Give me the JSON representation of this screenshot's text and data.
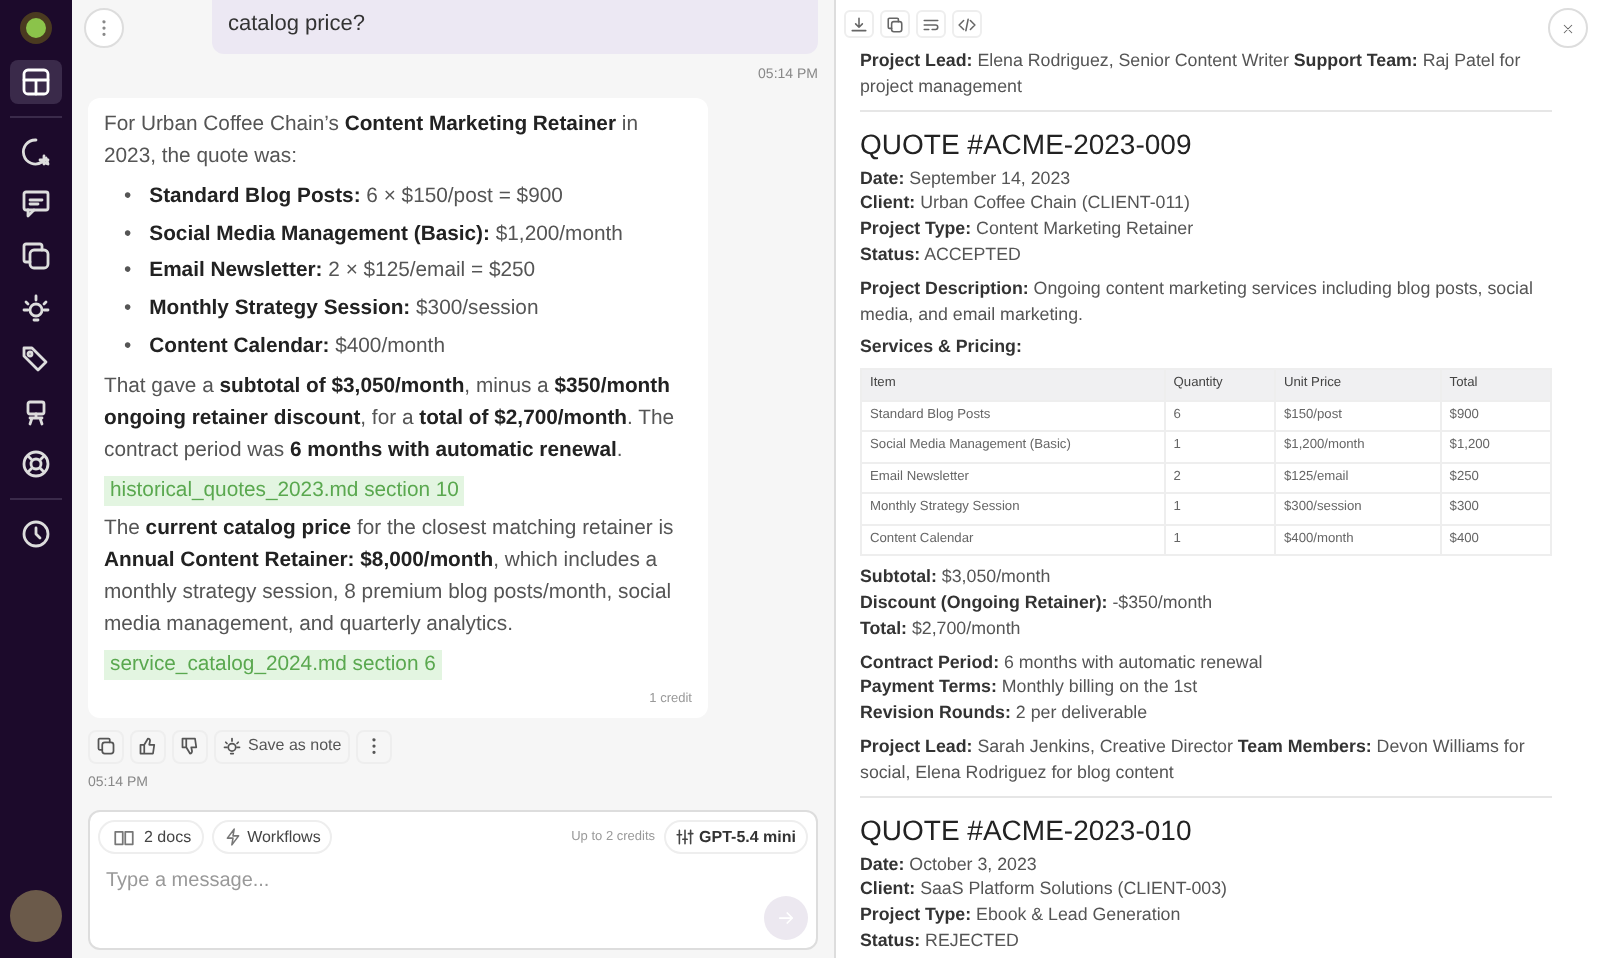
{
  "sidebar": {
    "items": [
      {
        "selected": true
      },
      {
        "selected": false
      },
      {
        "selected": false
      },
      {
        "selected": false
      },
      {
        "selected": false
      },
      {
        "selected": false
      },
      {
        "selected": false
      },
      {
        "selected": false
      },
      {
        "selected": false
      }
    ]
  },
  "chat": {
    "messages": [
      {
        "kind": "user",
        "text": "catalog price?",
        "time": "05:14 PM"
      },
      {
        "kind": "assistant",
        "blocks": [
          {
            "kind": "para",
            "text": "For Urban Coffee Chain’s **Content Marketing Retainer** in 2023, the quote was:"
          },
          {
            "kind": "list",
            "marker": "•",
            "items": [
              "**Standard Blog Posts:** 6 × $150/post = $900",
              "**Social Media Management (Basic):** $1,200/month",
              "**Email Newsletter:** 2 × $125/email = $250",
              "**Monthly Strategy Session:** $300/session",
              "**Content Calendar:** $400/month"
            ]
          },
          {
            "kind": "para",
            "text": "That gave a **subtotal of $3,050/month**, minus a **$350/month ongoing retainer discount**, for a **total of $2,700/month**. The contract period was **6 months with automatic renewal**.",
            "citation": "historical_quotes_2023.md section 10"
          },
          {
            "kind": "para",
            "text": "The **current catalog price** for the closest matching retainer is **Annual Content Retainer: $8,000/month**, which includes a monthly strategy session, 8 premium blog posts/month, social media management, and quarterly analytics.",
            "citation": "service_catalog_2024.md section 6"
          }
        ],
        "credit": "1 credit",
        "actions": {
          "save_label": "Save as note"
        },
        "time": "05:14 PM"
      }
    ]
  },
  "composer": {
    "docs": "2 docs",
    "workflows": "Workflows",
    "credits_note": "Up to 2 credits",
    "model": "GPT-5.4 mini",
    "placeholder": "Type a message..."
  },
  "document": {
    "blocks": [
      {
        "kind": "para",
        "text": "**Project Lead:** Elena Rodriguez, Senior Content Writer **Support Team:** Raj Patel for project management"
      },
      {
        "kind": "hr"
      },
      {
        "kind": "heading",
        "text": "QUOTE #ACME-2023-009"
      },
      {
        "kind": "fields",
        "items": [
          "**Date:** September 14, 2023",
          "**Client:** Urban Coffee Chain (CLIENT-011)",
          "**Project Type:** Content Marketing Retainer",
          "**Status:** ACCEPTED"
        ]
      },
      {
        "kind": "para",
        "text": "**Project Description:** Ongoing content marketing services including blog posts, social media, and email marketing."
      },
      {
        "kind": "para",
        "text": "**Services & Pricing:**"
      },
      {
        "kind": "table",
        "columns": [
          "Item",
          "Quantity",
          "Unit Price",
          "Total"
        ],
        "rows": [
          [
            "Standard Blog Posts",
            "6",
            "$150/post",
            "$900"
          ],
          [
            "Social Media Management (Basic)",
            "1",
            "$1,200/month",
            "$1,200"
          ],
          [
            "Email Newsletter",
            "2",
            "$125/email",
            "$250"
          ],
          [
            "Monthly Strategy Session",
            "1",
            "$300/session",
            "$300"
          ],
          [
            "Content Calendar",
            "1",
            "$400/month",
            "$400"
          ]
        ]
      },
      {
        "kind": "fields",
        "items": [
          "**Subtotal:** $3,050/month",
          "**Discount (Ongoing Retainer):** -$350/month",
          "**Total:** $2,700/month"
        ]
      },
      {
        "kind": "fields",
        "items": [
          "**Contract Period:** 6 months with automatic renewal",
          "**Payment Terms:** Monthly billing on the 1st",
          "**Revision Rounds:** 2 per deliverable"
        ]
      },
      {
        "kind": "para",
        "text": "**Project Lead:** Sarah Jenkins, Creative Director **Team Members:** Devon Williams for social, Elena Rodriguez for blog content"
      },
      {
        "kind": "hr"
      },
      {
        "kind": "heading",
        "text": "QUOTE #ACME-2023-010"
      },
      {
        "kind": "fields",
        "items": [
          "**Date:** October 3, 2023",
          "**Client:** SaaS Platform Solutions (CLIENT-003)",
          "**Project Type:** Ebook & Lead Generation",
          "**Status:** REJECTED"
        ]
      }
    ]
  }
}
